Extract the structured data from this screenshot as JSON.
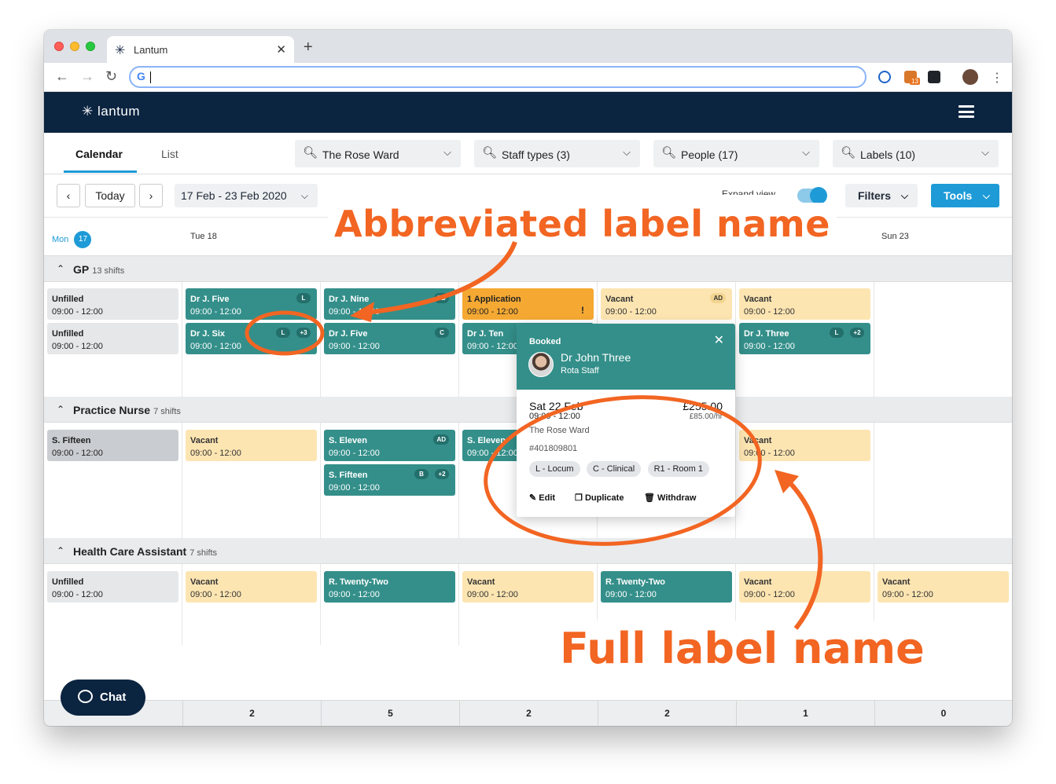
{
  "browser": {
    "tab_title": "Lantum",
    "tab_favicon": "lantum-star-icon",
    "new_tab_label": "+",
    "close_tab_label": "✕",
    "address_value": "",
    "extension_badge": "13"
  },
  "app": {
    "logo_text": "lantum",
    "logo_mark": "✳"
  },
  "view_tabs": {
    "calendar": "Calendar",
    "list": "List"
  },
  "filters": {
    "ward": "The Rose Ward",
    "staff_types": "Staff types (3)",
    "people": "People (17)",
    "labels": "Labels (10)"
  },
  "datebar": {
    "today_label": "Today",
    "range": "17 Feb - 23 Feb 2020",
    "expand_label": "Expand view",
    "filters_label": "Filters",
    "tools_label": "Tools"
  },
  "days": {
    "mon": "Mon",
    "mon_num": "17",
    "tue": "Tue 18",
    "sun": "Sun 23"
  },
  "sections": {
    "gp": {
      "title": "GP",
      "count": "13 shifts"
    },
    "nurse": {
      "title": "Practice Nurse",
      "count": "7 shifts"
    },
    "hca": {
      "title": "Health Care Assistant",
      "count": "7 shifts"
    }
  },
  "gp_shifts": [
    {
      "name": "Unfilled",
      "time": "09:00 - 12:00"
    },
    {
      "name": "Unfilled",
      "time": "09:00 - 12:00"
    },
    {
      "name": "Dr J. Five",
      "time": "09:00 - 12:00",
      "chip": "L"
    },
    {
      "name": "Dr J. Six",
      "time": "09:00 - 12:00",
      "chip": "L",
      "chip2": "+3"
    },
    {
      "name": "Dr J. Nine",
      "time": "09:00 - 12:00",
      "chip": "SD"
    },
    {
      "name": "Dr J. Five",
      "time": "09:00 - 12:00",
      "chip": "C"
    },
    {
      "name": "1 Application",
      "time": "09:00 - 12:00",
      "warn": "!"
    },
    {
      "name": "Dr J. Ten",
      "time": "09:00 - 12:00"
    },
    {
      "name": "Vacant",
      "time": "09:00 - 12:00",
      "chip": "AD"
    },
    {
      "name": "Vacant",
      "time": "09:00 - 12:00"
    },
    {
      "name": "Dr J. Three",
      "time": "09:00 - 12:00",
      "chip": "L",
      "chip2": "+2"
    }
  ],
  "nurse_shifts": [
    {
      "name": "S. Fifteen",
      "time": "09:00 - 12:00"
    },
    {
      "name": "Vacant",
      "time": "09:00 - 12:00"
    },
    {
      "name": "S. Eleven",
      "time": "09:00 - 12:00",
      "chip": "AD"
    },
    {
      "name": "S. Fifteen",
      "time": "09:00 - 12:00",
      "chip": "B",
      "chip2": "+2"
    },
    {
      "name": "S. Eleven",
      "time": "09:00 - 12:00"
    },
    {
      "name": "Vacant",
      "time": "09:00 - 12:00"
    }
  ],
  "hca_shifts": [
    {
      "name": "Unfilled",
      "time": "09:00 - 12:00"
    },
    {
      "name": "Vacant",
      "time": "09:00 - 12:00"
    },
    {
      "name": "R. Twenty-Two",
      "time": "09:00 - 12:00"
    },
    {
      "name": "Vacant",
      "time": "09:00 - 12:00"
    },
    {
      "name": "R. Twenty-Two",
      "time": "09:00 - 12:00"
    },
    {
      "name": "Vacant",
      "time": "09:00 - 12:00"
    },
    {
      "name": "Vacant",
      "time": "09:00 - 12:00"
    }
  ],
  "popover": {
    "status": "Booked",
    "name": "Dr John Three",
    "role": "Rota Staff",
    "date": "Sat 22 Feb",
    "price": "£255.00",
    "time": "09:00 - 12:00",
    "rate": "£85.00/hr",
    "ward": "The Rose Ward",
    "id": "#401809801",
    "labels": [
      "L - Locum",
      "C - Clinical",
      "R1 - Room 1"
    ],
    "edit": "Edit",
    "duplicate": "Duplicate",
    "withdraw": "Withdraw"
  },
  "footer_counts": [
    "2",
    "5",
    "2",
    "2",
    "1",
    "0"
  ],
  "chat_label": "Chat",
  "annotations": {
    "top": "Abbreviated label name",
    "bottom": "Full label name",
    "color": "#f26522"
  },
  "colors": {
    "header_navy": "#0b2440",
    "accent_blue": "#1e9bd7",
    "booked_teal": "#348f8a",
    "vacant_peach": "#fde5b2",
    "application_orange": "#f5a933"
  }
}
